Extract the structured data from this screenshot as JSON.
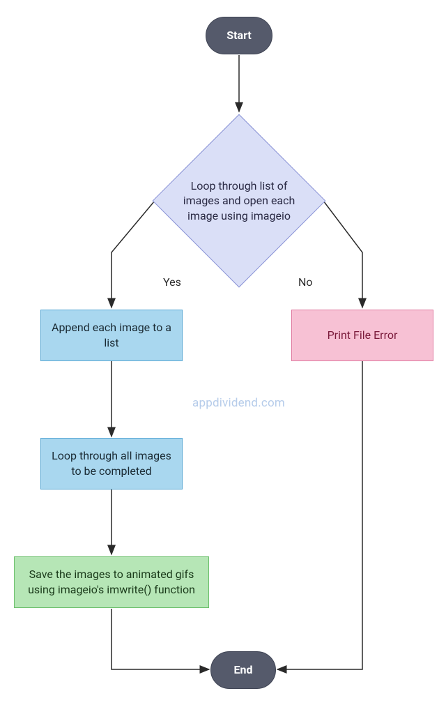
{
  "nodes": {
    "start": "Start",
    "decision": "Loop through list of images and open each image using imageio",
    "append": "Append each image to a list",
    "error": "Print File Error",
    "loop": "Loop through all images to be completed",
    "save": "Save the images to animated gifs using imageio's imwrite() function",
    "end": "End"
  },
  "edges": {
    "yes": "Yes",
    "no": "No"
  },
  "watermark": "appdividend.com",
  "colors": {
    "terminal_bg": "#555a6b",
    "diamond_bg": "#dadff7",
    "blue_bg": "#a9d7ef",
    "pink_bg": "#f7c1d4",
    "green_bg": "#b6e6b6"
  }
}
